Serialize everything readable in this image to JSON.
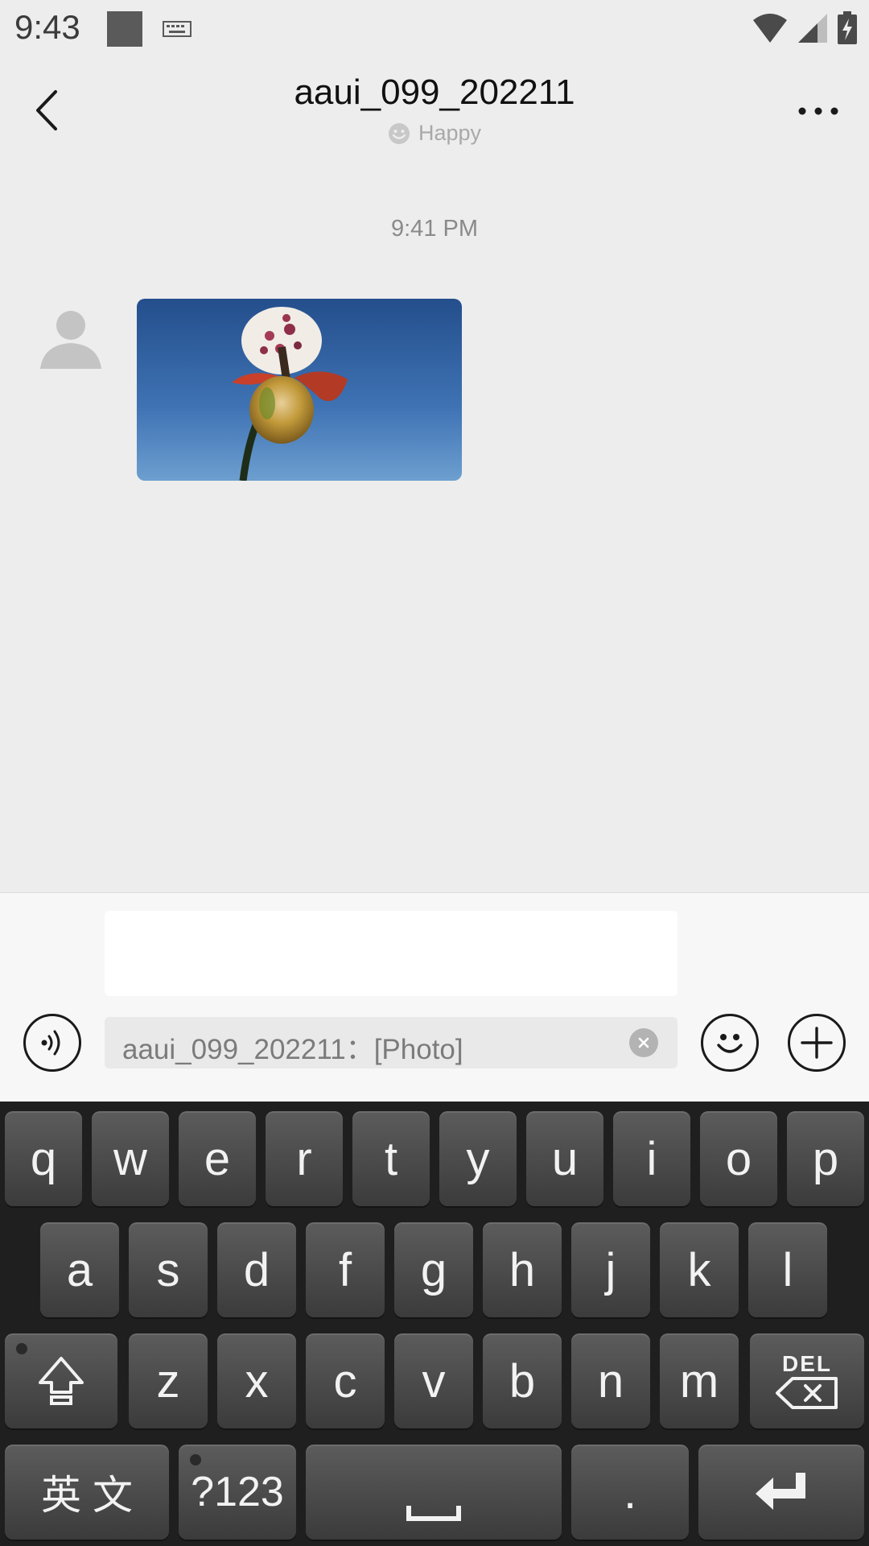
{
  "status_bar": {
    "time": "9:43"
  },
  "header": {
    "title": "aaui_099_202211",
    "status_text": "Happy"
  },
  "chat": {
    "timestamp": "9:41 PM"
  },
  "input": {
    "quote_text": "aaui_099_202211：[Photo]"
  },
  "keyboard": {
    "row1": [
      "q",
      "w",
      "e",
      "r",
      "t",
      "y",
      "u",
      "i",
      "o",
      "p"
    ],
    "row2": [
      "a",
      "s",
      "d",
      "f",
      "g",
      "h",
      "j",
      "k",
      "l"
    ],
    "row3": [
      "z",
      "x",
      "c",
      "v",
      "b",
      "n",
      "m"
    ],
    "del_label": "DEL",
    "lang_label": "英 文",
    "sym_label": "?123",
    "period_label": "."
  }
}
